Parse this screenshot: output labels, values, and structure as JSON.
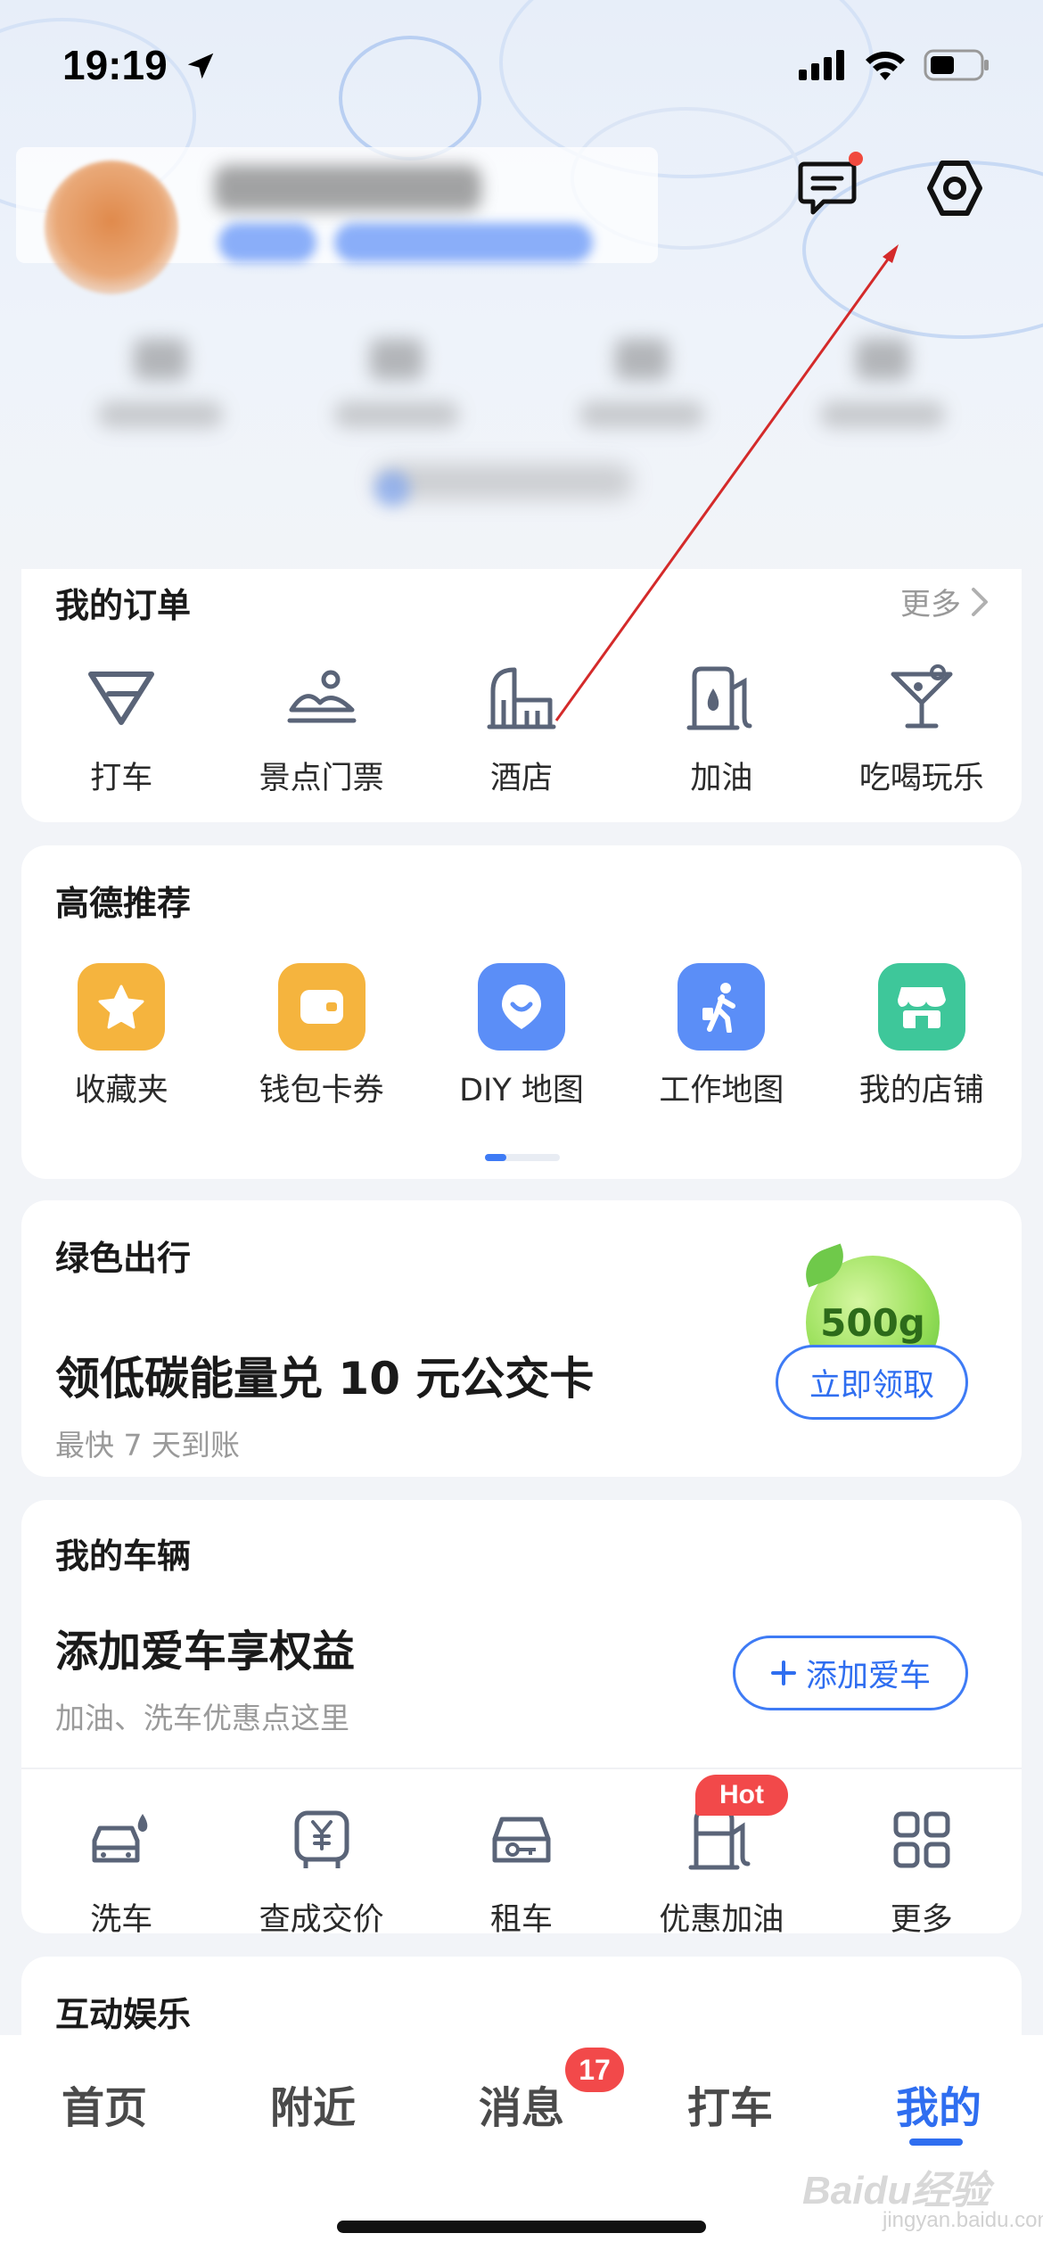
{
  "status_bar": {
    "time": "19:19"
  },
  "orders": {
    "title": "我的订单",
    "more": "更多",
    "items": [
      {
        "label": "打车",
        "icon": "taxi-icon"
      },
      {
        "label": "景点门票",
        "icon": "scenic-ticket-icon"
      },
      {
        "label": "酒店",
        "icon": "hotel-icon"
      },
      {
        "label": "加油",
        "icon": "fuel-icon"
      },
      {
        "label": "吃喝玩乐",
        "icon": "cocktail-icon"
      }
    ]
  },
  "recommend": {
    "title": "高德推荐",
    "items": [
      {
        "label": "收藏夹",
        "icon": "star-icon",
        "color": "#f5b43e"
      },
      {
        "label": "钱包卡券",
        "icon": "wallet-icon",
        "color": "#f5b43e"
      },
      {
        "label": "DIY 地图",
        "icon": "map-pin-icon",
        "color": "#5b8ef7"
      },
      {
        "label": "工作地图",
        "icon": "walking-person-icon",
        "color": "#5b8ef7"
      },
      {
        "label": "我的店铺",
        "icon": "store-icon",
        "color": "#3ec79a"
      }
    ]
  },
  "green": {
    "title": "绿色出行",
    "headline": "领低碳能量兑 10 元公交卡",
    "sub": "最快 7 天到账",
    "badge": "500g",
    "button": "立即领取"
  },
  "vehicle": {
    "title": "我的车辆",
    "headline": "添加爱车享权益",
    "sub": "加油、洗车优惠点这里",
    "button": "添加爱车",
    "hot": "Hot",
    "items": [
      {
        "label": "洗车",
        "icon": "car-wash-icon"
      },
      {
        "label": "查成交价",
        "icon": "price-car-icon"
      },
      {
        "label": "租车",
        "icon": "car-rental-icon"
      },
      {
        "label": "优惠加油",
        "icon": "fuel-discount-icon"
      },
      {
        "label": "更多",
        "icon": "grid-more-icon"
      }
    ]
  },
  "entertainment": {
    "title": "互动娱乐"
  },
  "tabbar": {
    "tabs": [
      "首页",
      "附近",
      "消息",
      "打车",
      "我的"
    ],
    "active": "我的",
    "message_badge": "17"
  },
  "watermark": {
    "main": "Baidu经验",
    "sub": "jingyan.baidu.com"
  },
  "colors": {
    "accent": "#2f6ef0",
    "badge_red": "#f2494a",
    "icon_gray": "#5a6478",
    "annotation_arrow": "#d42a2a"
  }
}
